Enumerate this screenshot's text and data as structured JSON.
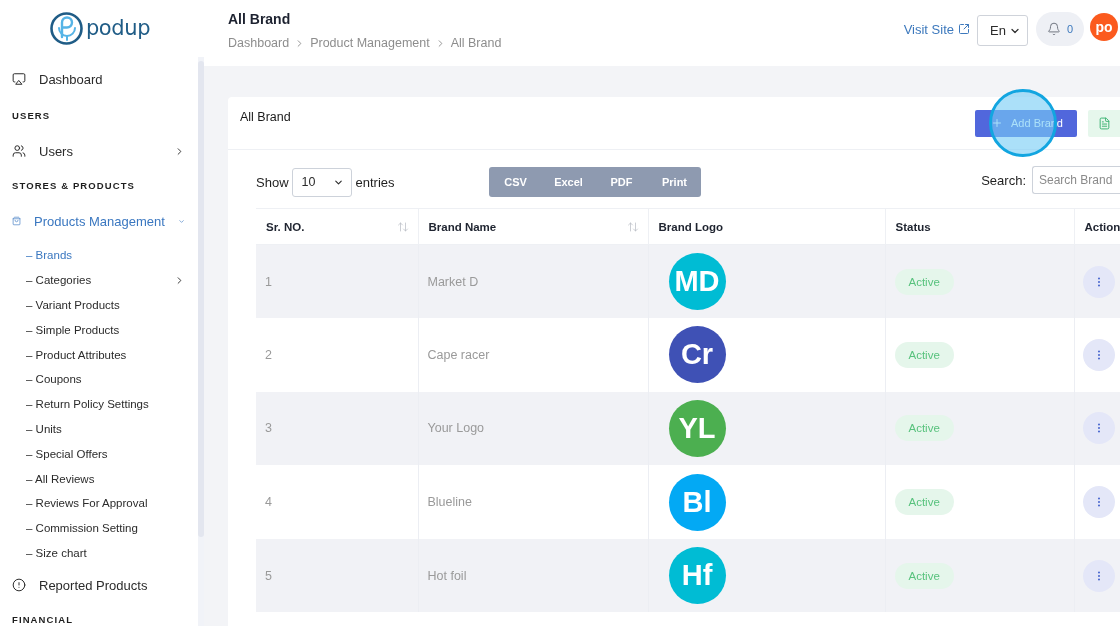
{
  "logo": {
    "text": "podup"
  },
  "sidebar": {
    "items": [
      {
        "kind": "link",
        "label": "Dashboard",
        "selected": false
      },
      {
        "kind": "heading",
        "label": "USERS"
      },
      {
        "kind": "group",
        "label": "Users",
        "selected": false,
        "expanded": false
      },
      {
        "kind": "heading",
        "label": "STORES & PRODUCTS"
      },
      {
        "kind": "group",
        "label": "Products Management",
        "selected": true,
        "expanded": true,
        "children": [
          {
            "label": "– Brands",
            "selected": true,
            "submenu": false
          },
          {
            "label": "– Categories",
            "selected": false,
            "submenu": true
          },
          {
            "label": "– Variant Products",
            "selected": false,
            "submenu": false
          },
          {
            "label": "– Simple Products",
            "selected": false,
            "submenu": false
          },
          {
            "label": "– Product Attributes",
            "selected": false,
            "submenu": false
          },
          {
            "label": "– Coupons",
            "selected": false,
            "submenu": false
          },
          {
            "label": "– Return Policy Settings",
            "selected": false,
            "submenu": false
          },
          {
            "label": "– Units",
            "selected": false,
            "submenu": false
          },
          {
            "label": "– Special Offers",
            "selected": false,
            "submenu": false
          },
          {
            "label": "– All Reviews",
            "selected": false,
            "submenu": false
          },
          {
            "label": "– Reviews For Approval",
            "selected": false,
            "submenu": false
          },
          {
            "label": "– Commission Setting",
            "selected": false,
            "submenu": false
          },
          {
            "label": "– Size chart",
            "selected": false,
            "submenu": false
          }
        ]
      },
      {
        "kind": "link",
        "label": "Reported Products",
        "selected": false
      },
      {
        "kind": "heading",
        "label": "FINANCIAL"
      }
    ]
  },
  "header": {
    "title": "All Brand",
    "breadcrumb": [
      "Dashboard",
      "Product Management",
      "All Brand"
    ],
    "visit_site": "Visit Site",
    "language": "En",
    "notifications": "0",
    "avatar": "po"
  },
  "card": {
    "title": "All Brand",
    "add_button": {
      "label": "Add Brand",
      "highlighted": true
    },
    "show_label": "Show",
    "entries_value": "10",
    "entries_label": "entries",
    "export_buttons": [
      "CSV",
      "Excel",
      "PDF",
      "Print"
    ],
    "search_label": "Search:",
    "search_placeholder": "Search Brand"
  },
  "table": {
    "columns": [
      {
        "label": "Sr. NO.",
        "sortable": true
      },
      {
        "label": "Brand Name",
        "sortable": true
      },
      {
        "label": "Brand Logo",
        "sortable": false
      },
      {
        "label": "Status",
        "sortable": false
      },
      {
        "label": "Action",
        "sortable": false
      }
    ],
    "rows": [
      {
        "sr": "1",
        "name": "Market D",
        "logo": {
          "initials": "MD",
          "color": "#00bcd4"
        },
        "status": "Active"
      },
      {
        "sr": "2",
        "name": "Cape racer",
        "logo": {
          "initials": "Cr",
          "color": "#3f51b5"
        },
        "status": "Active"
      },
      {
        "sr": "3",
        "name": "Your Logo",
        "logo": {
          "initials": "YL",
          "color": "#4caf50"
        },
        "status": "Active"
      },
      {
        "sr": "4",
        "name": "Blueline",
        "logo": {
          "initials": "Bl",
          "color": "#03a9f4"
        },
        "status": "Active"
      },
      {
        "sr": "5",
        "name": "Hot foil",
        "logo": {
          "initials": "Hf",
          "color": "#00bcd4"
        },
        "status": "Active"
      }
    ]
  }
}
